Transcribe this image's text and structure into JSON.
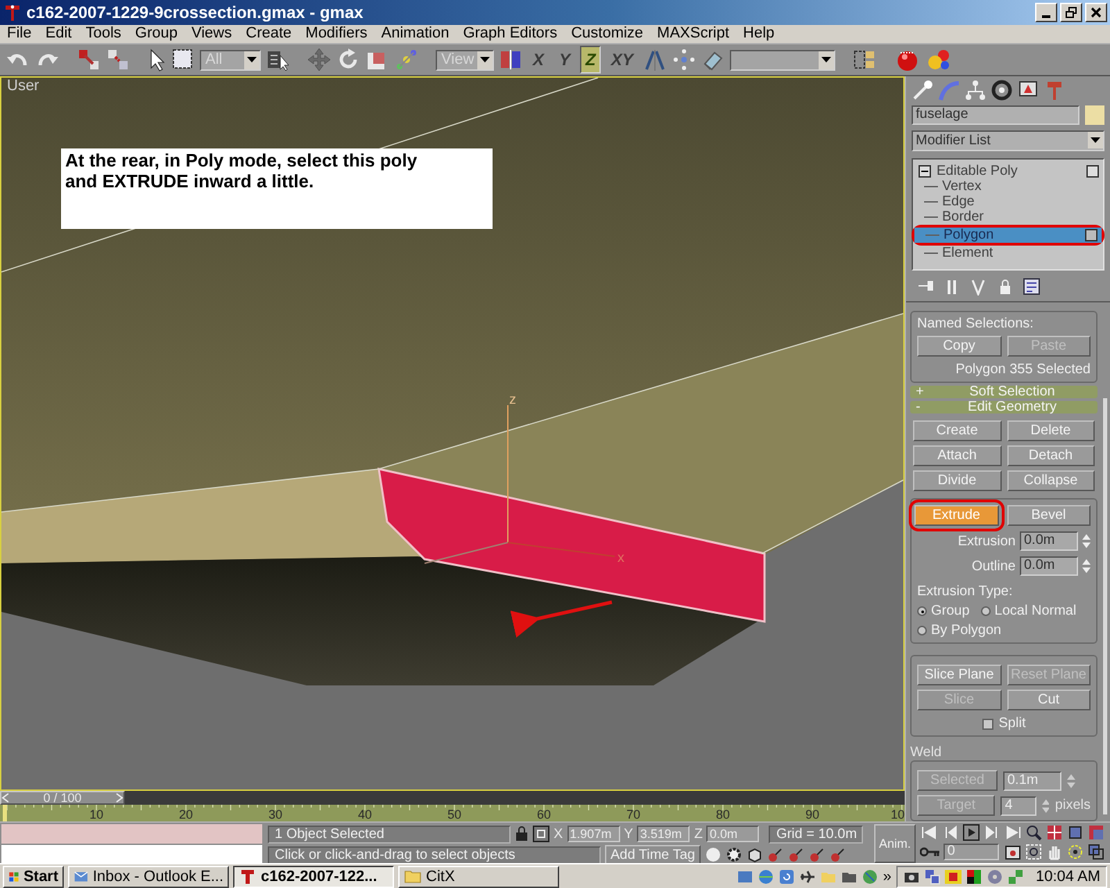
{
  "window": {
    "title": "c162-2007-1229-9crossection.gmax - gmax"
  },
  "menu": [
    "File",
    "Edit",
    "Tools",
    "Group",
    "Views",
    "Create",
    "Modifiers",
    "Animation",
    "Graph Editors",
    "Customize",
    "MAXScript",
    "Help"
  ],
  "toolbar": {
    "selection_filter": "All",
    "reference_coordinate": "View",
    "axis_constraints": [
      {
        "label": "X",
        "selected": false
      },
      {
        "label": "Y",
        "selected": false
      },
      {
        "label": "Z",
        "selected": true
      },
      {
        "label": "XY",
        "selected": false
      }
    ]
  },
  "viewport": {
    "label": "User",
    "note": "At the rear, in Poly mode, select this poly and EXTRUDE inward a little.",
    "gizmo_labels": [
      "z",
      "x"
    ]
  },
  "command_panel": {
    "object_name": "fuselage",
    "modifier_list": "Modifier List",
    "stack": {
      "label": "Editable Poly",
      "expanded": true,
      "children": [
        {
          "label": "Vertex",
          "selected": false,
          "highlighted": false
        },
        {
          "label": "Edge",
          "selected": false,
          "highlighted": false
        },
        {
          "label": "Border",
          "selected": false,
          "highlighted": false
        },
        {
          "label": "Polygon",
          "selected": true,
          "highlighted": true
        },
        {
          "label": "Element",
          "selected": false,
          "highlighted": false
        }
      ]
    },
    "named_selections": {
      "title": "Named Selections:",
      "buttons": [
        {
          "label": "Copy",
          "disabled": false
        },
        {
          "label": "Paste",
          "disabled": true
        }
      ],
      "info": "Polygon 355 Selected"
    },
    "rollouts": [
      {
        "sign": "+",
        "title": "Soft Selection"
      },
      {
        "sign": "-",
        "title": "Edit Geometry"
      }
    ],
    "geometry_buttons": [
      {
        "label": "Create",
        "disabled": false
      },
      {
        "label": "Delete",
        "disabled": false
      },
      {
        "label": "Attach",
        "disabled": false
      },
      {
        "label": "Detach",
        "disabled": false
      },
      {
        "label": "Divide",
        "disabled": false
      },
      {
        "label": "Collapse",
        "disabled": false
      }
    ],
    "extrude": {
      "buttons": [
        {
          "label": "Extrude",
          "active": true,
          "highlighted": true
        },
        {
          "label": "Bevel",
          "active": false,
          "highlighted": false
        }
      ],
      "spinners": [
        {
          "label": "Extrusion",
          "value": "0.0m"
        },
        {
          "label": "Outline",
          "value": "0.0m"
        }
      ],
      "type_label": "Extrusion Type:",
      "types": [
        {
          "label": "Group",
          "selected": true
        },
        {
          "label": "Local Normal",
          "selected": false
        },
        {
          "label": "By Polygon",
          "selected": false
        }
      ]
    },
    "slice": {
      "buttons": [
        {
          "label": "Slice Plane",
          "disabled": false
        },
        {
          "label": "Reset Plane",
          "disabled": true
        },
        {
          "label": "Slice",
          "disabled": true
        },
        {
          "label": "Cut",
          "disabled": false
        }
      ],
      "split": {
        "label": "Split",
        "checked": false
      }
    },
    "weld": {
      "title": "Weld",
      "disabled": true,
      "rows": [
        {
          "button": "Selected",
          "value": "0.1m"
        },
        {
          "button": "Target",
          "value": "4",
          "unit": "pixels"
        }
      ]
    }
  },
  "timeline": {
    "frame": "0 / 100",
    "level": 0,
    "ticks": [
      "10",
      "20",
      "30",
      "40",
      "50",
      "60",
      "70",
      "80",
      "90",
      "10"
    ]
  },
  "status": {
    "selection": "1 Object Selected",
    "prompt": "Click or click-and-drag to select objects",
    "coords": [
      {
        "axis": "X",
        "value": "1.907m"
      },
      {
        "axis": "Y",
        "value": "3.519m"
      },
      {
        "axis": "Z",
        "value": "0.0m"
      }
    ],
    "grid": "Grid = 10.0m",
    "add_time_tag": "Add Time Tag",
    "anim": "Anim.",
    "current_frame": "0"
  },
  "taskbar": {
    "start": "Start",
    "tasks": [
      {
        "label": "Inbox - Outlook E...",
        "selected": false
      },
      {
        "label": "c162-2007-122...",
        "selected": true
      },
      {
        "label": "CitX",
        "selected": false
      }
    ],
    "tray_more": "»",
    "clock": "10:04 AM"
  }
}
